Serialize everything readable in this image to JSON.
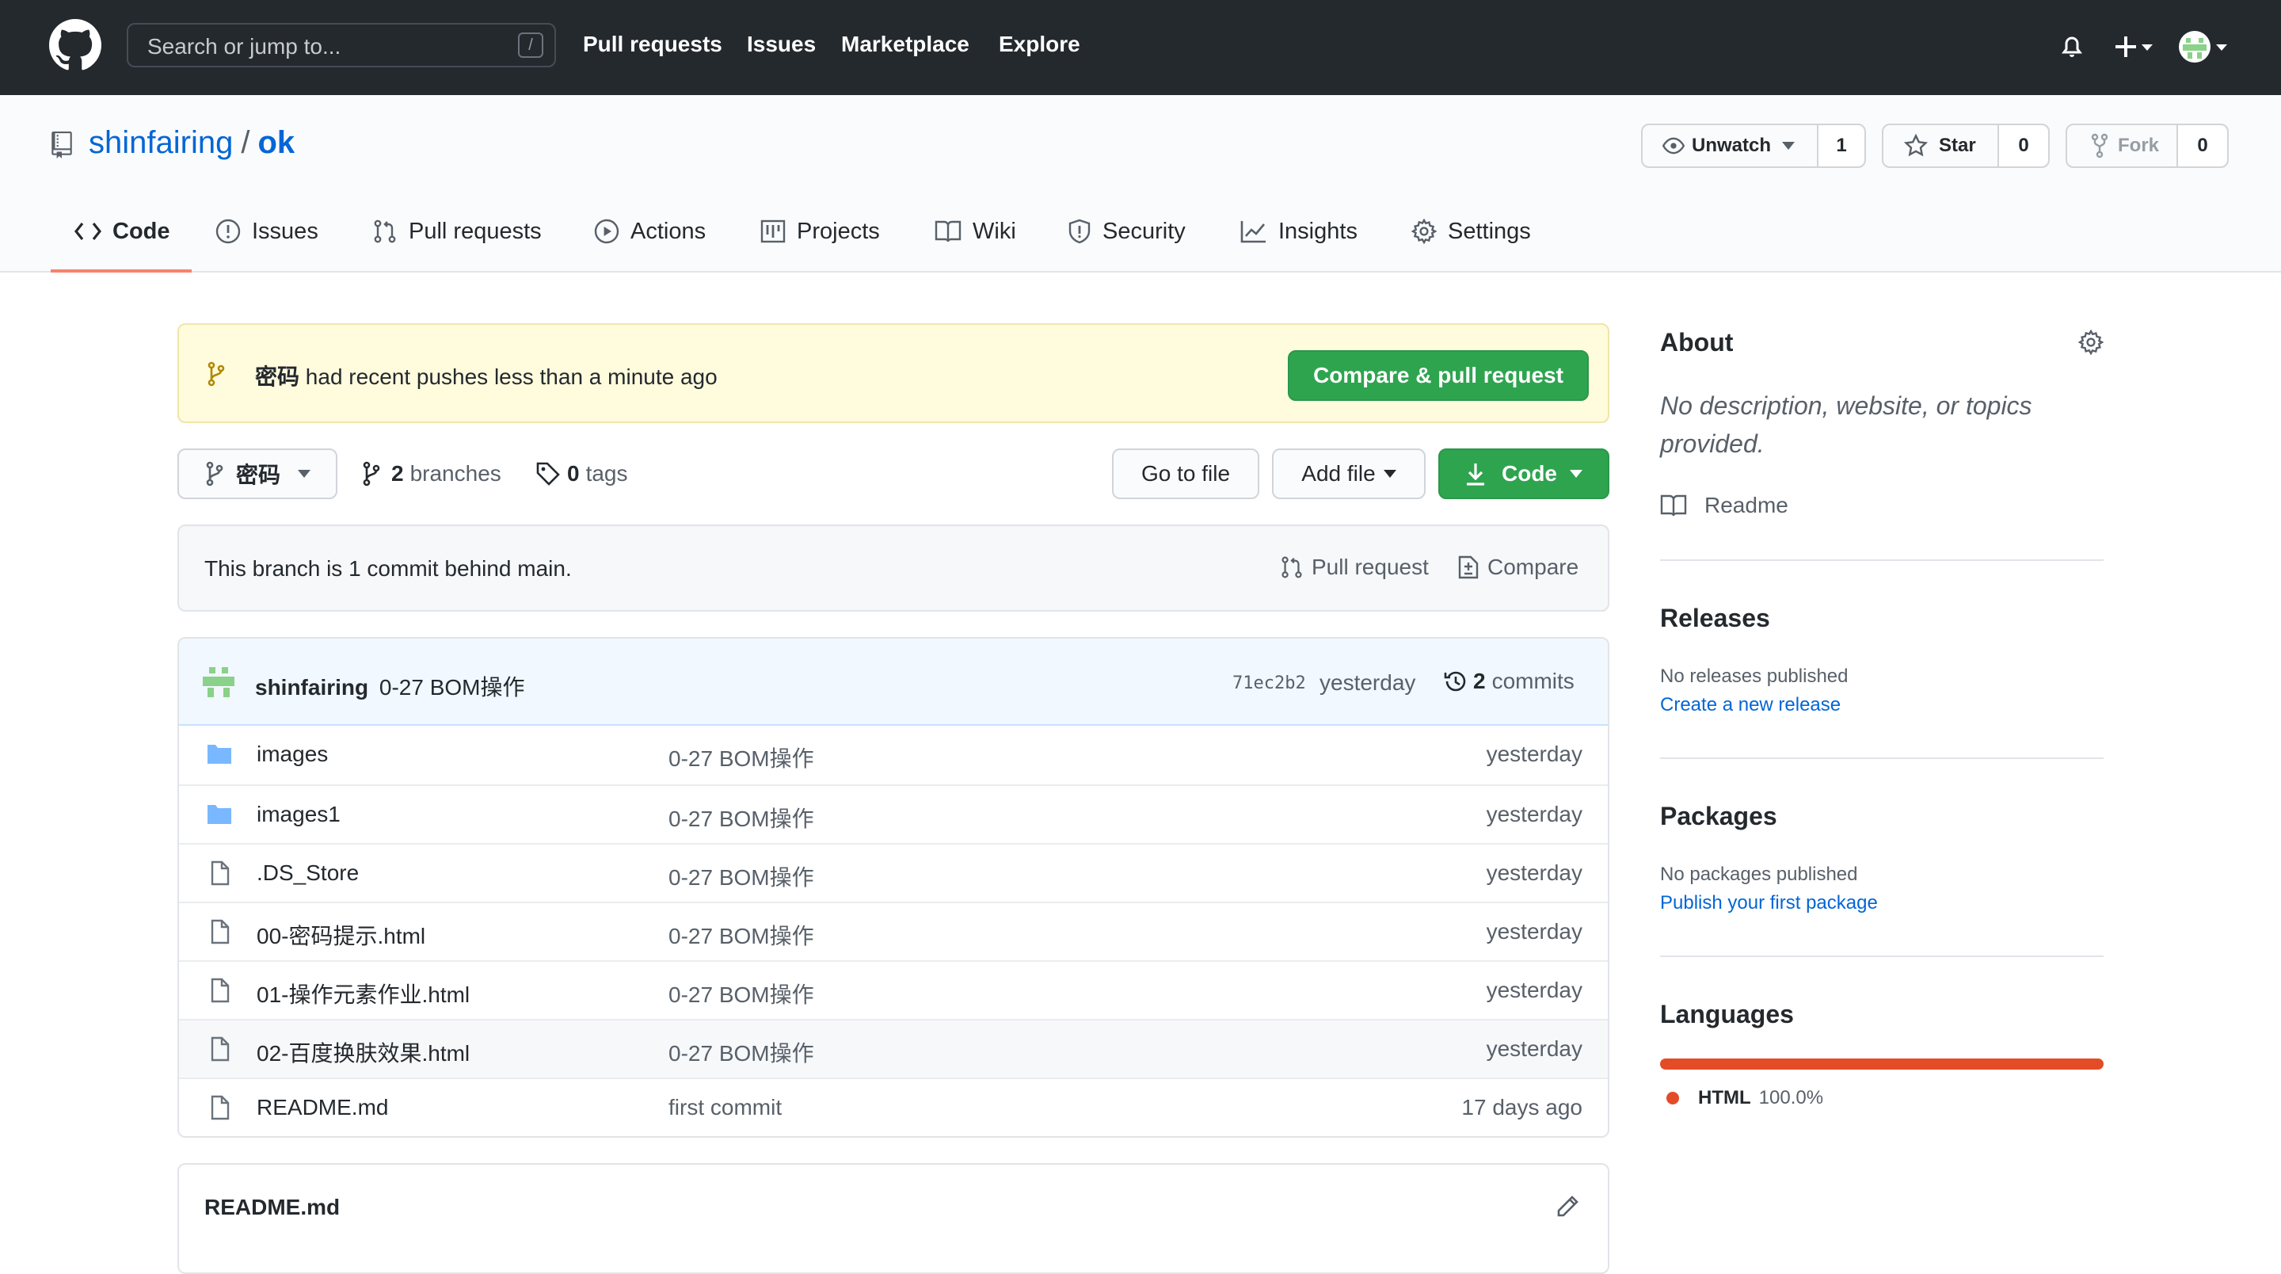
{
  "header": {
    "search_placeholder": "Search or jump to...",
    "search_shortcut": "/",
    "nav": [
      "Pull requests",
      "Issues",
      "Marketplace",
      "Explore"
    ]
  },
  "repo": {
    "owner": "shinfairing",
    "separator": "/",
    "name": "ok",
    "watch": {
      "label": "Unwatch",
      "count": "1"
    },
    "star": {
      "label": "Star",
      "count": "0"
    },
    "fork": {
      "label": "Fork",
      "count": "0"
    }
  },
  "tabs": [
    "Code",
    "Issues",
    "Pull requests",
    "Actions",
    "Projects",
    "Wiki",
    "Security",
    "Insights",
    "Settings"
  ],
  "banner": {
    "branch": "密码",
    "text": " had recent pushes less than a minute ago",
    "button": "Compare & pull request"
  },
  "toolbar": {
    "branch": "密码",
    "branches_count": "2",
    "branches_label": "branches",
    "tags_count": "0",
    "tags_label": "tags",
    "go_to_file": "Go to file",
    "add_file": "Add file",
    "code": "Code"
  },
  "behind": {
    "text": "This branch is 1 commit behind main.",
    "pull_request": "Pull request",
    "compare": "Compare"
  },
  "latest_commit": {
    "author": "shinfairing",
    "message": "0-27 BOM操作",
    "sha": "71ec2b2",
    "time": "yesterday",
    "commits_count": "2",
    "commits_label": "commits"
  },
  "files": [
    {
      "type": "dir",
      "name": "images",
      "message": "0-27 BOM操作",
      "age": "yesterday"
    },
    {
      "type": "dir",
      "name": "images1",
      "message": "0-27 BOM操作",
      "age": "yesterday"
    },
    {
      "type": "file",
      "name": ".DS_Store",
      "message": "0-27 BOM操作",
      "age": "yesterday"
    },
    {
      "type": "file",
      "name": "00-密码提示.html",
      "message": "0-27 BOM操作",
      "age": "yesterday"
    },
    {
      "type": "file",
      "name": "01-操作元素作业.html",
      "message": "0-27 BOM操作",
      "age": "yesterday"
    },
    {
      "type": "file",
      "name": "02-百度换肤效果.html",
      "message": "0-27 BOM操作",
      "age": "yesterday"
    },
    {
      "type": "file",
      "name": "README.md",
      "message": "first commit",
      "age": "17 days ago"
    }
  ],
  "readme": {
    "title": "README.md"
  },
  "sidebar": {
    "about_title": "About",
    "about_desc": "No description, website, or topics provided.",
    "readme_label": "Readme",
    "releases_title": "Releases",
    "releases_none": "No releases published",
    "releases_link": "Create a new release",
    "packages_title": "Packages",
    "packages_none": "No packages published",
    "packages_link": "Publish your first package",
    "languages_title": "Languages",
    "language_name": "HTML",
    "language_percent": "100.0%",
    "language_share": 1.0,
    "language_color": "#e34c26"
  },
  "colors": {
    "header_bg": "#24292e",
    "link": "#0366d6",
    "green_button": "#2ea44f",
    "banner_bg": "#fffbdd",
    "tab_underline": "#f9826c"
  }
}
